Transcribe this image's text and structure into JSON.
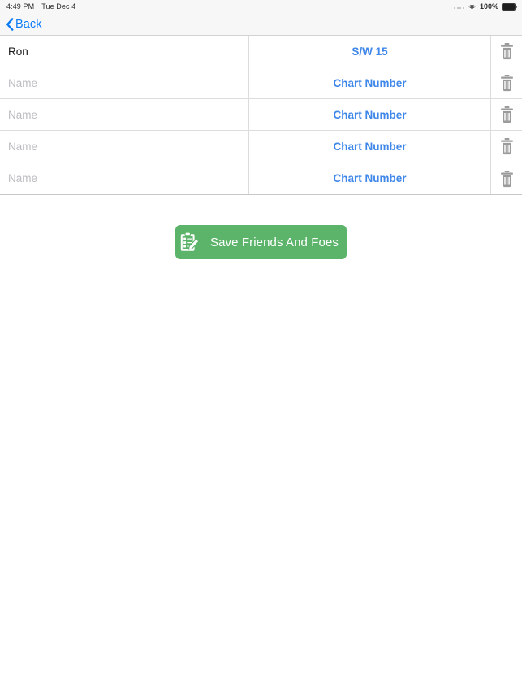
{
  "status_bar": {
    "time": "4:49 PM",
    "date": "Tue Dec 4",
    "battery_percent": "100%",
    "wifi_icon": "wifi-icon",
    "signal_icon": "signal-dots-icon",
    "battery_icon": "battery-full-icon"
  },
  "nav": {
    "back_label": "Back",
    "back_icon": "chevron-left-icon",
    "background": "#F7F7F7",
    "tint": "#0b7bf5"
  },
  "table": {
    "name_placeholder": "Name",
    "chart_placeholder": "Chart Number",
    "delete_icon": "trash-icon",
    "rows": [
      {
        "name": "Ron",
        "name_filled": true,
        "chart": "S/W 15",
        "chart_filled": true
      },
      {
        "name": "Name",
        "name_filled": false,
        "chart": "Chart Number",
        "chart_filled": false
      },
      {
        "name": "Name",
        "name_filled": false,
        "chart": "Chart Number",
        "chart_filled": false
      },
      {
        "name": "Name",
        "name_filled": false,
        "chart": "Chart Number",
        "chart_filled": false
      },
      {
        "name": "Name",
        "name_filled": false,
        "chart": "Chart Number",
        "chart_filled": false
      }
    ]
  },
  "save": {
    "label": "Save Friends And Foes",
    "icon": "clipboard-pencil-icon",
    "color": "#5cb36a",
    "text_color": "#ffffff"
  },
  "colors": {
    "accent_blue": "#3f87e8",
    "link_blue": "#0b7bf5",
    "green": "#5cb36a",
    "placeholder_gray": "#bcbcc2",
    "divider": "#dcdcdc",
    "chrome": "#F7F7F7"
  }
}
